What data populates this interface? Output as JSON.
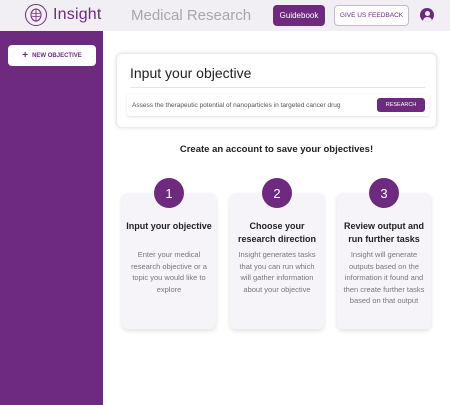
{
  "header": {
    "logo_text": "Insight",
    "app_title": "Medical Research",
    "guidebook_label": "Guidebook",
    "feedback_label": "GIVE US FEEDBACK",
    "avatar_icon": "user-circle-icon"
  },
  "sidebar": {
    "new_objective_label": "NEW OBJECTIVE",
    "plus_icon": "+"
  },
  "objective": {
    "title": "Input your objective",
    "input_value": "Assess the therapeutic potential of nanoparticles in targeted cancer drug",
    "research_label": "RESEARCH"
  },
  "create_account_text": "Create an account to save your objectives!",
  "steps": [
    {
      "number": "1",
      "title": "Input your objective",
      "description": "Enter your medical research objective or a topic you would like to explore"
    },
    {
      "number": "2",
      "title": "Choose your research direction",
      "description": "Insight generates tasks that you can run which will gather information about your objective"
    },
    {
      "number": "3",
      "title": "Review output and run further tasks",
      "description": "Insight will generate outputs based on the information it found and then create further tasks based on that output"
    }
  ],
  "colors": {
    "brand": "#6d2a7e",
    "sidebar": "#6d2a7e",
    "header_bg": "#f1eff4",
    "muted_title": "#a8a6ad"
  }
}
